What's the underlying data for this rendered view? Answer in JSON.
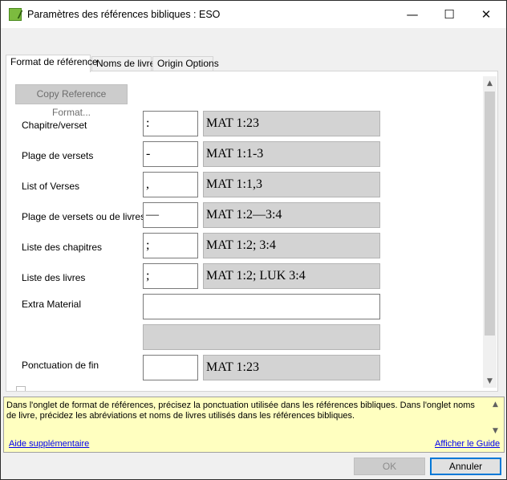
{
  "window": {
    "title": "Paramètres des références bibliques : ESO",
    "controls": {
      "minimize": "—",
      "maximize": "☐",
      "close": "✕"
    }
  },
  "tabs": [
    {
      "label": "Format de référence",
      "active": true
    },
    {
      "label": "Noms de livre",
      "active": false
    },
    {
      "label": "Origin Options",
      "active": false
    }
  ],
  "format_tab": {
    "copy_button": "Copy Reference Format...",
    "rows": [
      {
        "label": "Chapitre/verset",
        "separator": ":",
        "example": "MAT 1:23"
      },
      {
        "label": "Plage de versets",
        "separator": "-",
        "example": "MAT 1:1-3"
      },
      {
        "label": "List of Verses",
        "separator": ",",
        "example": "MAT 1:1,3"
      },
      {
        "label": "Plage de versets ou de livres",
        "separator": "—",
        "example": "MAT 1:2—3:4"
      },
      {
        "label": "Liste des chapitres",
        "separator": ";",
        "example": "MAT 1:2; 3:4"
      },
      {
        "label": "Liste des livres",
        "separator": ";",
        "example": "MAT 1:2; LUK 3:4"
      }
    ],
    "extra_material": {
      "label": "Extra Material",
      "value": "",
      "preview": ""
    },
    "final_punctuation": {
      "label": "Ponctuation de fin",
      "value": "",
      "example": "MAT 1:23"
    }
  },
  "help": {
    "text": "Dans l'onglet de format de références, précisez la ponctuation utilisée dans les références bibliques. Dans l'onglet noms de livre, précidez les abréviations et noms de livres utilisés dans les références bibliques.",
    "more_link": "Aide supplémentaire",
    "guide_link": "Afficher le Guide"
  },
  "buttons": {
    "ok": "OK",
    "cancel": "Annuler"
  },
  "colors": {
    "help_background": "#ffffc0",
    "link": "#0000ee",
    "focus_border": "#0078d7"
  }
}
